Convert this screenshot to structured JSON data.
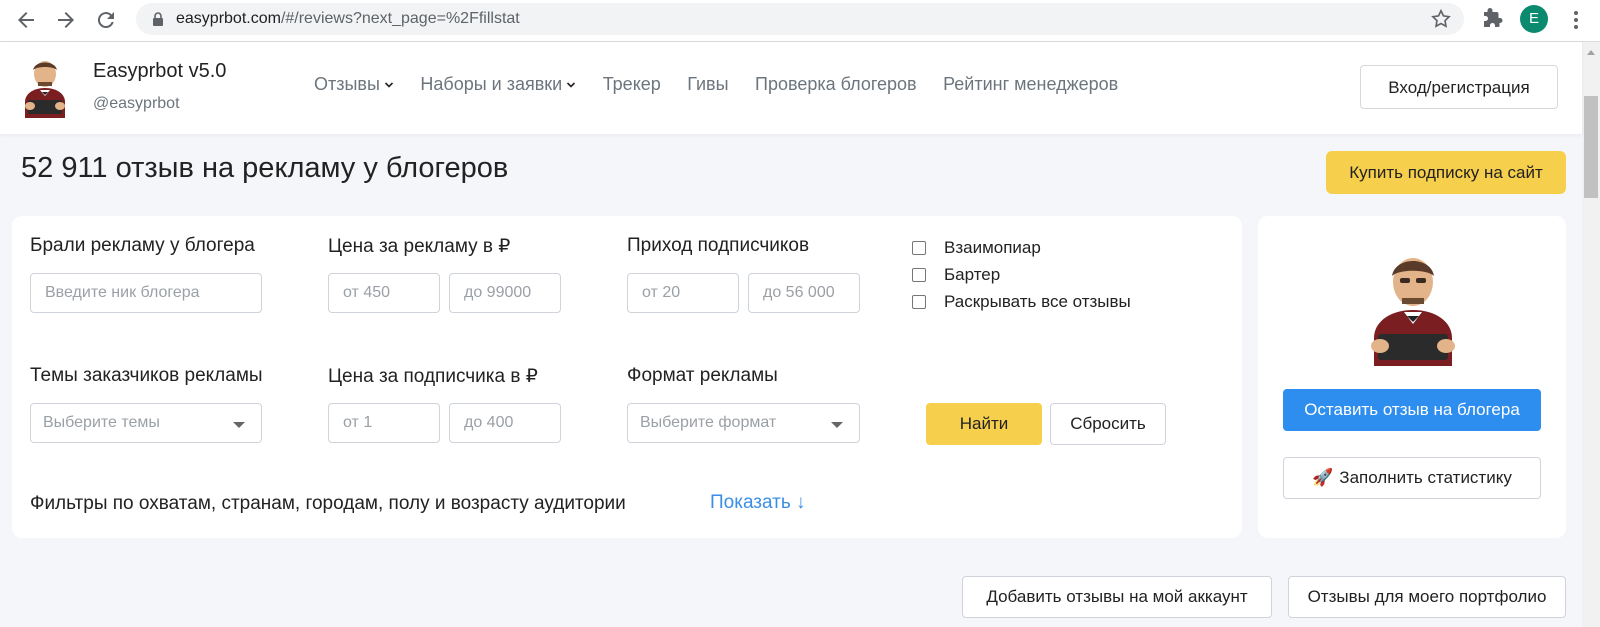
{
  "browser": {
    "url_host": "easyprbot.com",
    "url_path": "/#/reviews?next_page=%2Ffillstat",
    "profile_initial": "E"
  },
  "header": {
    "brand_name": "Easyprbot v5.0",
    "brand_handle": "@easyprbot",
    "nav": [
      {
        "label": "Отзывы",
        "dropdown": true
      },
      {
        "label": "Наборы и заявки",
        "dropdown": true
      },
      {
        "label": "Трекер",
        "dropdown": false
      },
      {
        "label": "Гивы",
        "dropdown": false
      },
      {
        "label": "Проверка блогеров",
        "dropdown": false
      },
      {
        "label": "Рейтинг менеджеров",
        "dropdown": false
      }
    ],
    "login_label": "Вход/регистрация"
  },
  "page": {
    "title": "52 911 отзыв на рекламу у блогеров",
    "subscribe_label": "Купить подписку на сайт"
  },
  "filters": {
    "blogger_label": "Брали рекламу у блогера",
    "blogger_placeholder": "Введите ник блогера",
    "price_label": "Цена за рекламу в ₽",
    "price_from_placeholder": "от 450",
    "price_to_placeholder": "до 99000",
    "subs_label": "Приход подписчиков",
    "subs_from_placeholder": "от 20",
    "subs_to_placeholder": "до 56 000",
    "checkboxes": [
      "Взаимопиар",
      "Бартер",
      "Раскрывать все отзывы"
    ],
    "themes_label": "Темы заказчиков рекламы",
    "themes_placeholder": "Выберите темы",
    "cps_label": "Цена за подписчика в ₽",
    "cps_from_placeholder": "от 1",
    "cps_to_placeholder": "до 400",
    "format_label": "Формат рекламы",
    "format_placeholder": "Выберите формат",
    "find_label": "Найти",
    "reset_label": "Сбросить",
    "extra_label": "Фильтры по охватам, странам, городам, полу и возрасту аудитории",
    "show_label": "Показать ↓"
  },
  "side": {
    "review_label": "Оставить отзыв на блогера",
    "stats_icon": "🚀",
    "stats_label": "Заполнить статистику"
  },
  "bottom": {
    "add_reviews_label": "Добавить отзывы на мой аккаунт",
    "portfolio_label": "Отзывы для моего портфолио"
  },
  "colors": {
    "accent_yellow": "#f6cf4d",
    "accent_blue": "#2d8ef0",
    "link_blue": "#3b8ee6",
    "background": "#f4f6fa"
  },
  "icons": [
    "back-arrow-icon",
    "forward-arrow-icon",
    "reload-icon",
    "lock-icon",
    "star-icon",
    "puzzle-icon",
    "kebab-menu-icon",
    "chevron-down-icon",
    "rocket-icon"
  ]
}
